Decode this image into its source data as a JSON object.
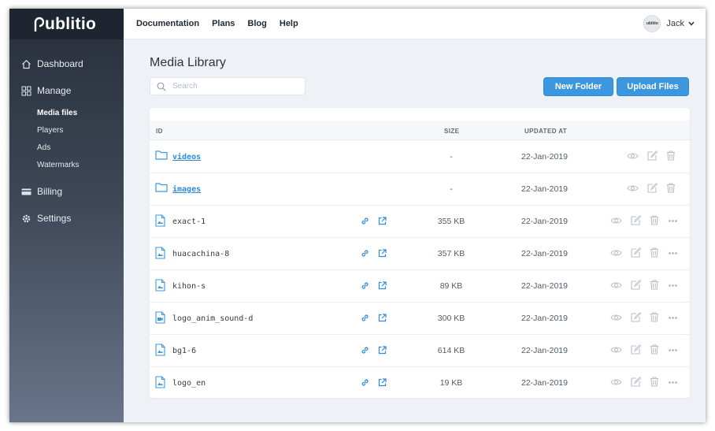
{
  "brand": {
    "logo_text": "ublitio"
  },
  "topnav": [
    "Documentation",
    "Plans",
    "Blog",
    "Help"
  ],
  "user": {
    "name": "Jack",
    "avatar_text": "ublitio"
  },
  "sidebar": {
    "items": [
      {
        "label": "Dashboard",
        "icon": "home-icon"
      },
      {
        "label": "Manage",
        "icon": "grid-icon"
      },
      {
        "label": "Billing",
        "icon": "credit-card-icon"
      },
      {
        "label": "Settings",
        "icon": "gear-icon"
      }
    ],
    "subitems": [
      "Media files",
      "Players",
      "Ads",
      "Watermarks"
    ],
    "active_subitem": "Media files"
  },
  "page": {
    "title": "Media Library",
    "search_placeholder": "Search",
    "new_folder_label": "New Folder",
    "upload_label": "Upload Files"
  },
  "table": {
    "headers": {
      "id": "ID",
      "size": "SIZE",
      "updated": "UPDATED AT"
    },
    "rows": [
      {
        "name": "videos",
        "type": "folder",
        "size": "-",
        "updated": "22-Jan-2019"
      },
      {
        "name": "images",
        "type": "folder",
        "size": "-",
        "updated": "22-Jan-2019"
      },
      {
        "name": "exact-1",
        "type": "file",
        "size": "355 KB",
        "updated": "22-Jan-2019"
      },
      {
        "name": "huacachina-8",
        "type": "file",
        "size": "357 KB",
        "updated": "22-Jan-2019"
      },
      {
        "name": "kihon-s",
        "type": "file",
        "size": "89 KB",
        "updated": "22-Jan-2019"
      },
      {
        "name": "logo_anim_sound-d",
        "type": "file",
        "size": "300 KB",
        "updated": "22-Jan-2019"
      },
      {
        "name": "bg1-6",
        "type": "file",
        "size": "614 KB",
        "updated": "22-Jan-2019"
      },
      {
        "name": "logo_en",
        "type": "file",
        "size": "19 KB",
        "updated": "22-Jan-2019"
      }
    ]
  },
  "colors": {
    "accent": "#3d97df",
    "link": "#2f8bd6",
    "sidebar_top": "#272f3a"
  }
}
